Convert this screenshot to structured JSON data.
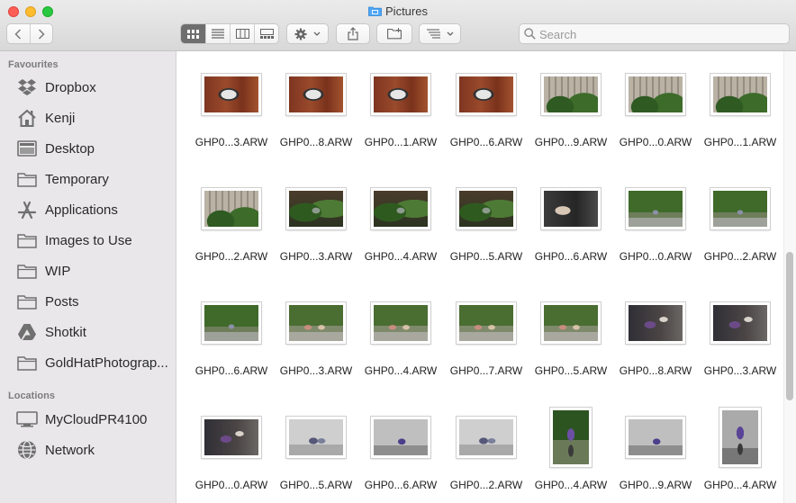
{
  "window": {
    "title": "Pictures"
  },
  "toolbar": {
    "back_icon": "chevron-left-icon",
    "forward_icon": "chevron-right-icon",
    "view_modes": [
      "icon-view-icon",
      "list-view-icon",
      "column-view-icon",
      "gallery-view-icon"
    ],
    "active_view": "icon-view-icon",
    "action_icon": "gear-icon",
    "share_icon": "share-icon",
    "new_folder_icon": "new-folder-icon",
    "arrange_icon": "arrange-icon",
    "search_placeholder": "Search"
  },
  "sidebar": {
    "favourites_header": "Favourites",
    "favourites": [
      {
        "label": "Dropbox",
        "icon": "dropbox-icon"
      },
      {
        "label": "Kenji",
        "icon": "home-icon"
      },
      {
        "label": "Desktop",
        "icon": "desktop-icon"
      },
      {
        "label": "Temporary",
        "icon": "folder-icon"
      },
      {
        "label": "Applications",
        "icon": "applications-icon"
      },
      {
        "label": "Images to Use",
        "icon": "folder-icon"
      },
      {
        "label": "WIP",
        "icon": "folder-icon"
      },
      {
        "label": "Posts",
        "icon": "folder-icon"
      },
      {
        "label": "Shotkit",
        "icon": "google-drive-icon"
      },
      {
        "label": "GoldHatPhotograp...",
        "icon": "folder-icon"
      }
    ],
    "locations_header": "Locations",
    "locations": [
      {
        "label": "MyCloudPR4100",
        "icon": "network-drive-icon"
      },
      {
        "label": "Network",
        "icon": "globe-icon"
      }
    ]
  },
  "files": [
    [
      {
        "name": "GHP0...3.ARW",
        "style": "img-wood",
        "orientation": "landscape"
      },
      {
        "name": "GHP0...8.ARW",
        "style": "img-wood",
        "orientation": "landscape"
      },
      {
        "name": "GHP0...1.ARW",
        "style": "img-wood",
        "orientation": "landscape"
      },
      {
        "name": "GHP0...6.ARW",
        "style": "img-wood",
        "orientation": "landscape"
      },
      {
        "name": "GHP0...9.ARW",
        "style": "img-fence",
        "orientation": "landscape"
      },
      {
        "name": "GHP0...0.ARW",
        "style": "img-fence",
        "orientation": "landscape"
      },
      {
        "name": "GHP0...1.ARW",
        "style": "img-fence",
        "orientation": "landscape"
      }
    ],
    [
      {
        "name": "GHP0...2.ARW",
        "style": "img-fence",
        "orientation": "landscape"
      },
      {
        "name": "GHP0...3.ARW",
        "style": "img-plant",
        "orientation": "landscape"
      },
      {
        "name": "GHP0...4.ARW",
        "style": "img-plant",
        "orientation": "landscape"
      },
      {
        "name": "GHP0...5.ARW",
        "style": "img-plant",
        "orientation": "landscape"
      },
      {
        "name": "GHP0...6.ARW",
        "style": "img-dark",
        "orientation": "landscape"
      },
      {
        "name": "GHP0...0.ARW",
        "style": "img-kidgreen",
        "orientation": "landscape"
      },
      {
        "name": "GHP0...2.ARW",
        "style": "img-kidgreen",
        "orientation": "landscape"
      }
    ],
    [
      {
        "name": "GHP0...6.ARW",
        "style": "img-kidgreen",
        "orientation": "landscape"
      },
      {
        "name": "GHP0...3.ARW",
        "style": "img-kidsgreen",
        "orientation": "landscape"
      },
      {
        "name": "GHP0...4.ARW",
        "style": "img-kidsgreen",
        "orientation": "landscape"
      },
      {
        "name": "GHP0...7.ARW",
        "style": "img-kidsgreen",
        "orientation": "landscape"
      },
      {
        "name": "GHP0...5.ARW",
        "style": "img-kidsgreen",
        "orientation": "landscape"
      },
      {
        "name": "GHP0...8.ARW",
        "style": "img-indoor",
        "orientation": "landscape"
      },
      {
        "name": "GHP0...3.ARW",
        "style": "img-indoor",
        "orientation": "landscape"
      }
    ],
    [
      {
        "name": "GHP0...0.ARW",
        "style": "img-indoor",
        "orientation": "landscape"
      },
      {
        "name": "GHP0...5.ARW",
        "style": "img-wall",
        "orientation": "landscape"
      },
      {
        "name": "GHP0...6.ARW",
        "style": "img-wallgray",
        "orientation": "landscape"
      },
      {
        "name": "GHP0...2.ARW",
        "style": "img-wall",
        "orientation": "landscape"
      },
      {
        "name": "GHP0...4.ARW",
        "style": "img-portrait",
        "orientation": "portrait"
      },
      {
        "name": "GHP0...9.ARW",
        "style": "img-wallgray",
        "orientation": "landscape"
      },
      {
        "name": "GHP0...4.ARW",
        "style": "img-portraitgray",
        "orientation": "portrait"
      }
    ]
  ]
}
